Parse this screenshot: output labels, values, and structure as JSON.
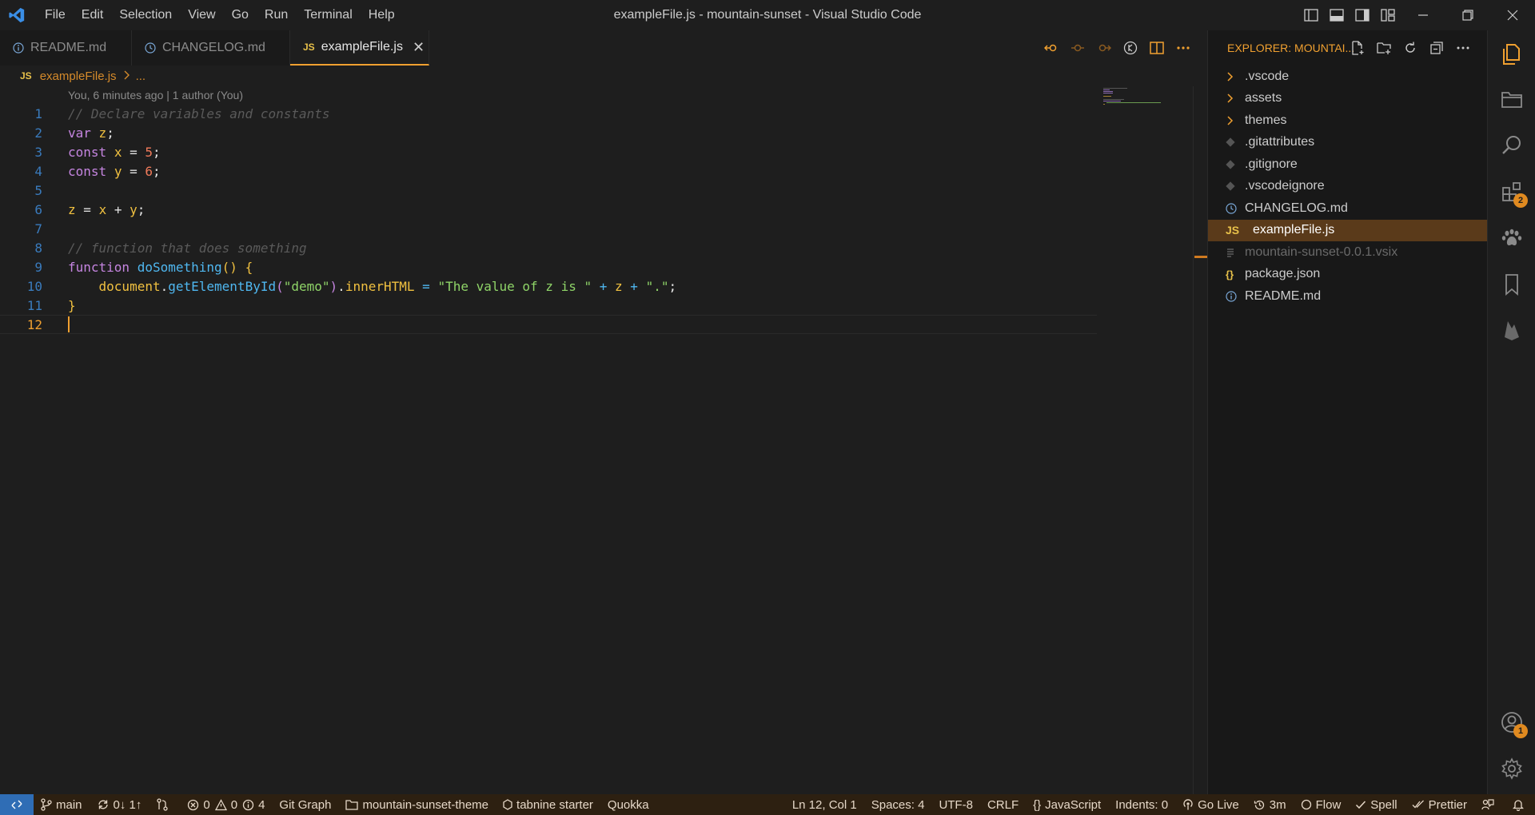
{
  "window": {
    "title": "exampleFile.js - mountain-sunset - Visual Studio Code",
    "menu": [
      "File",
      "Edit",
      "Selection",
      "View",
      "Go",
      "Run",
      "Terminal",
      "Help"
    ]
  },
  "tabs": [
    {
      "label": "README.md",
      "icon": "info-icon",
      "active": false
    },
    {
      "label": "CHANGELOG.md",
      "icon": "clock-icon",
      "active": false
    },
    {
      "label": "exampleFile.js",
      "icon": "js-icon",
      "active": true
    }
  ],
  "breadcrumb": {
    "file": "exampleFile.js",
    "more": "..."
  },
  "codelens": "You, 6 minutes ago | 1 author (You)",
  "editor": {
    "line_numbers": [
      "1",
      "2",
      "3",
      "4",
      "5",
      "6",
      "7",
      "8",
      "9",
      "10",
      "11",
      "12"
    ],
    "line1": "// Declare variables and constants",
    "line2": {
      "kw": "var",
      "v": "z",
      "p": ";"
    },
    "line3": {
      "kw": "const",
      "v": "x",
      "op": "=",
      "num": "5",
      "p": ";"
    },
    "line4": {
      "kw": "const",
      "v": "y",
      "op": "=",
      "num": "6",
      "p": ";"
    },
    "line6": {
      "a": "z",
      "eq": "=",
      "b": "x",
      "plus": "+",
      "c": "y",
      "p": ";"
    },
    "line8": "// function that does something",
    "line9": {
      "kw": "function",
      "fn": "doSomething",
      "p": "() {"
    },
    "line10": {
      "obj": "document",
      "dot": ".",
      "fn": "getElementById",
      "open": "(",
      "arg": "\"demo\"",
      "close": ")",
      "dot2": ".",
      "prop": "innerHTML",
      "eq": "=",
      "str": "\"The value of z is \"",
      "plus": "+",
      "z": "z",
      "plus2": "+",
      "str2": "\".\"",
      "semi": ";"
    },
    "line11": "}"
  },
  "explorer": {
    "header": "EXPLORER: MOUNTAI...",
    "items": [
      {
        "label": ".vscode",
        "type": "folder"
      },
      {
        "label": "assets",
        "type": "folder"
      },
      {
        "label": "themes",
        "type": "folder"
      },
      {
        "label": ".gitattributes",
        "type": "git"
      },
      {
        "label": ".gitignore",
        "type": "git"
      },
      {
        "label": ".vscodeignore",
        "type": "git"
      },
      {
        "label": "CHANGELOG.md",
        "type": "clock"
      },
      {
        "label": "exampleFile.js",
        "type": "js",
        "selected": true
      },
      {
        "label": "mountain-sunset-0.0.1.vsix",
        "type": "lines",
        "dim": true
      },
      {
        "label": "package.json",
        "type": "json"
      },
      {
        "label": "README.md",
        "type": "info"
      }
    ]
  },
  "activity": {
    "extensions_badge": "2",
    "accounts_badge": "1"
  },
  "status": {
    "branch": "main",
    "sync": "0↓ 1↑",
    "errors": "0",
    "warnings": "0",
    "infos": "4",
    "git_graph": "Git Graph",
    "folder": "mountain-sunset-theme",
    "tabnine": "tabnine starter",
    "quokka": "Quokka",
    "position": "Ln 12, Col 1",
    "spaces": "Spaces: 4",
    "encoding": "UTF-8",
    "eol": "CRLF",
    "language": "JavaScript",
    "indents": "Indents: 0",
    "golive": "Go Live",
    "time": "3m",
    "flow": "Flow",
    "spell": "Spell",
    "prettier": "Prettier"
  },
  "colors": {
    "accent": "#f0a030",
    "statusbar": "#2d2011",
    "remote": "#2f6db5",
    "selected": "#5a3a1a"
  }
}
